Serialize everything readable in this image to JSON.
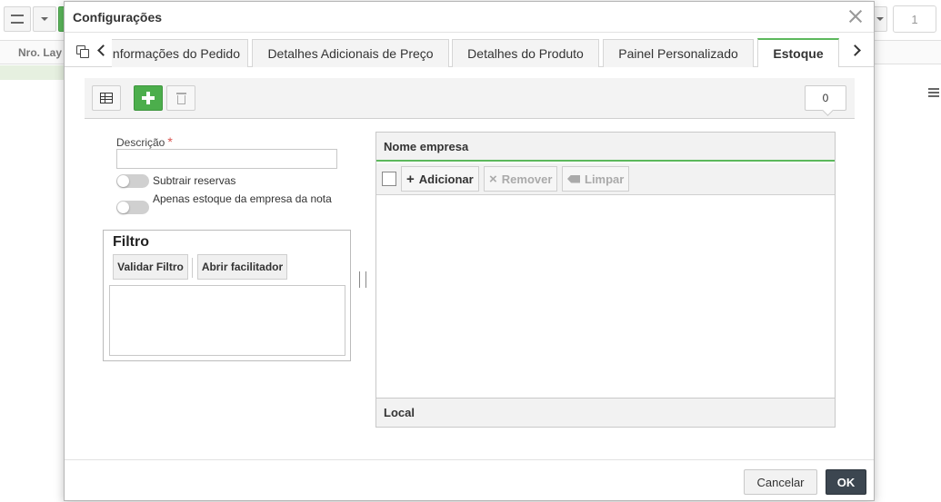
{
  "background": {
    "page_number": "1",
    "column_header": "Nro. Lay"
  },
  "modal": {
    "title": "Configurações",
    "tabs": [
      {
        "label": "Informações do Pedido"
      },
      {
        "label": "Detalhes Adicionais de Preço"
      },
      {
        "label": "Detalhes do Produto"
      },
      {
        "label": "Painel Personalizado"
      },
      {
        "label": "Estoque",
        "active": true
      }
    ],
    "toolbar": {
      "counter": "0"
    },
    "form": {
      "descricao_label": "Descrição",
      "required_mark": "*",
      "descricao_value": "",
      "subtrair_reservas_label": "Subtrair reservas",
      "apenas_estoque_label": "Apenas estoque da empresa da nota",
      "filtro": {
        "title": "Filtro",
        "validar_label": "Validar Filtro",
        "abrir_label": "Abrir facilitador",
        "text": ""
      }
    },
    "right_panel": {
      "header": "Nome empresa",
      "adicionar_label": "Adicionar",
      "remover_label": "Remover",
      "limpar_label": "Limpar",
      "footer_header": "Local"
    },
    "footer": {
      "cancel_label": "Cancelar",
      "ok_label": "OK"
    }
  },
  "colors": {
    "accent_green": "#5cb85c",
    "ok_button": "#3c4650"
  }
}
